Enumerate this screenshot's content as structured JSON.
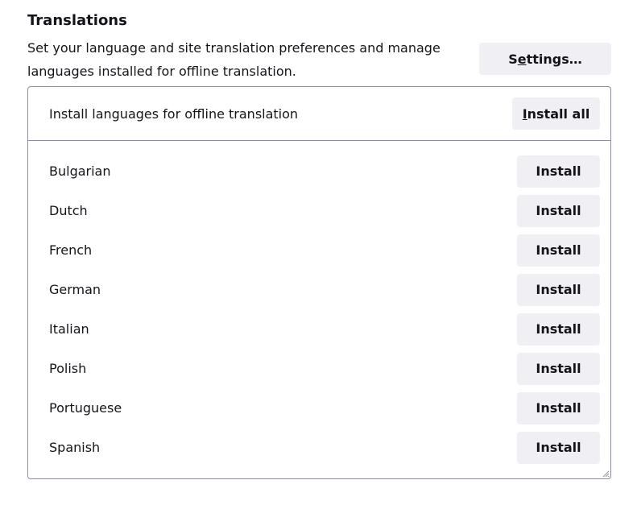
{
  "section": {
    "title": "Translations",
    "description": "Set your language and site translation preferences and manage languages installed for offline translation.",
    "settings_label_pre": "S",
    "settings_label_access": "e",
    "settings_label_post": "ttings…"
  },
  "offline": {
    "header_label": "Install languages for offline translation",
    "install_all_access": "I",
    "install_all_rest": "nstall all",
    "languages": [
      {
        "name": "Bulgarian",
        "action": "Install"
      },
      {
        "name": "Dutch",
        "action": "Install"
      },
      {
        "name": "French",
        "action": "Install"
      },
      {
        "name": "German",
        "action": "Install"
      },
      {
        "name": "Italian",
        "action": "Install"
      },
      {
        "name": "Polish",
        "action": "Install"
      },
      {
        "name": "Portuguese",
        "action": "Install"
      },
      {
        "name": "Spanish",
        "action": "Install"
      }
    ]
  },
  "icons": {
    "resize_grip": "resize-grip-icon"
  },
  "colors": {
    "button_bg": "#f0f0f4",
    "border": "#8f8f9d",
    "text": "#15141a"
  }
}
